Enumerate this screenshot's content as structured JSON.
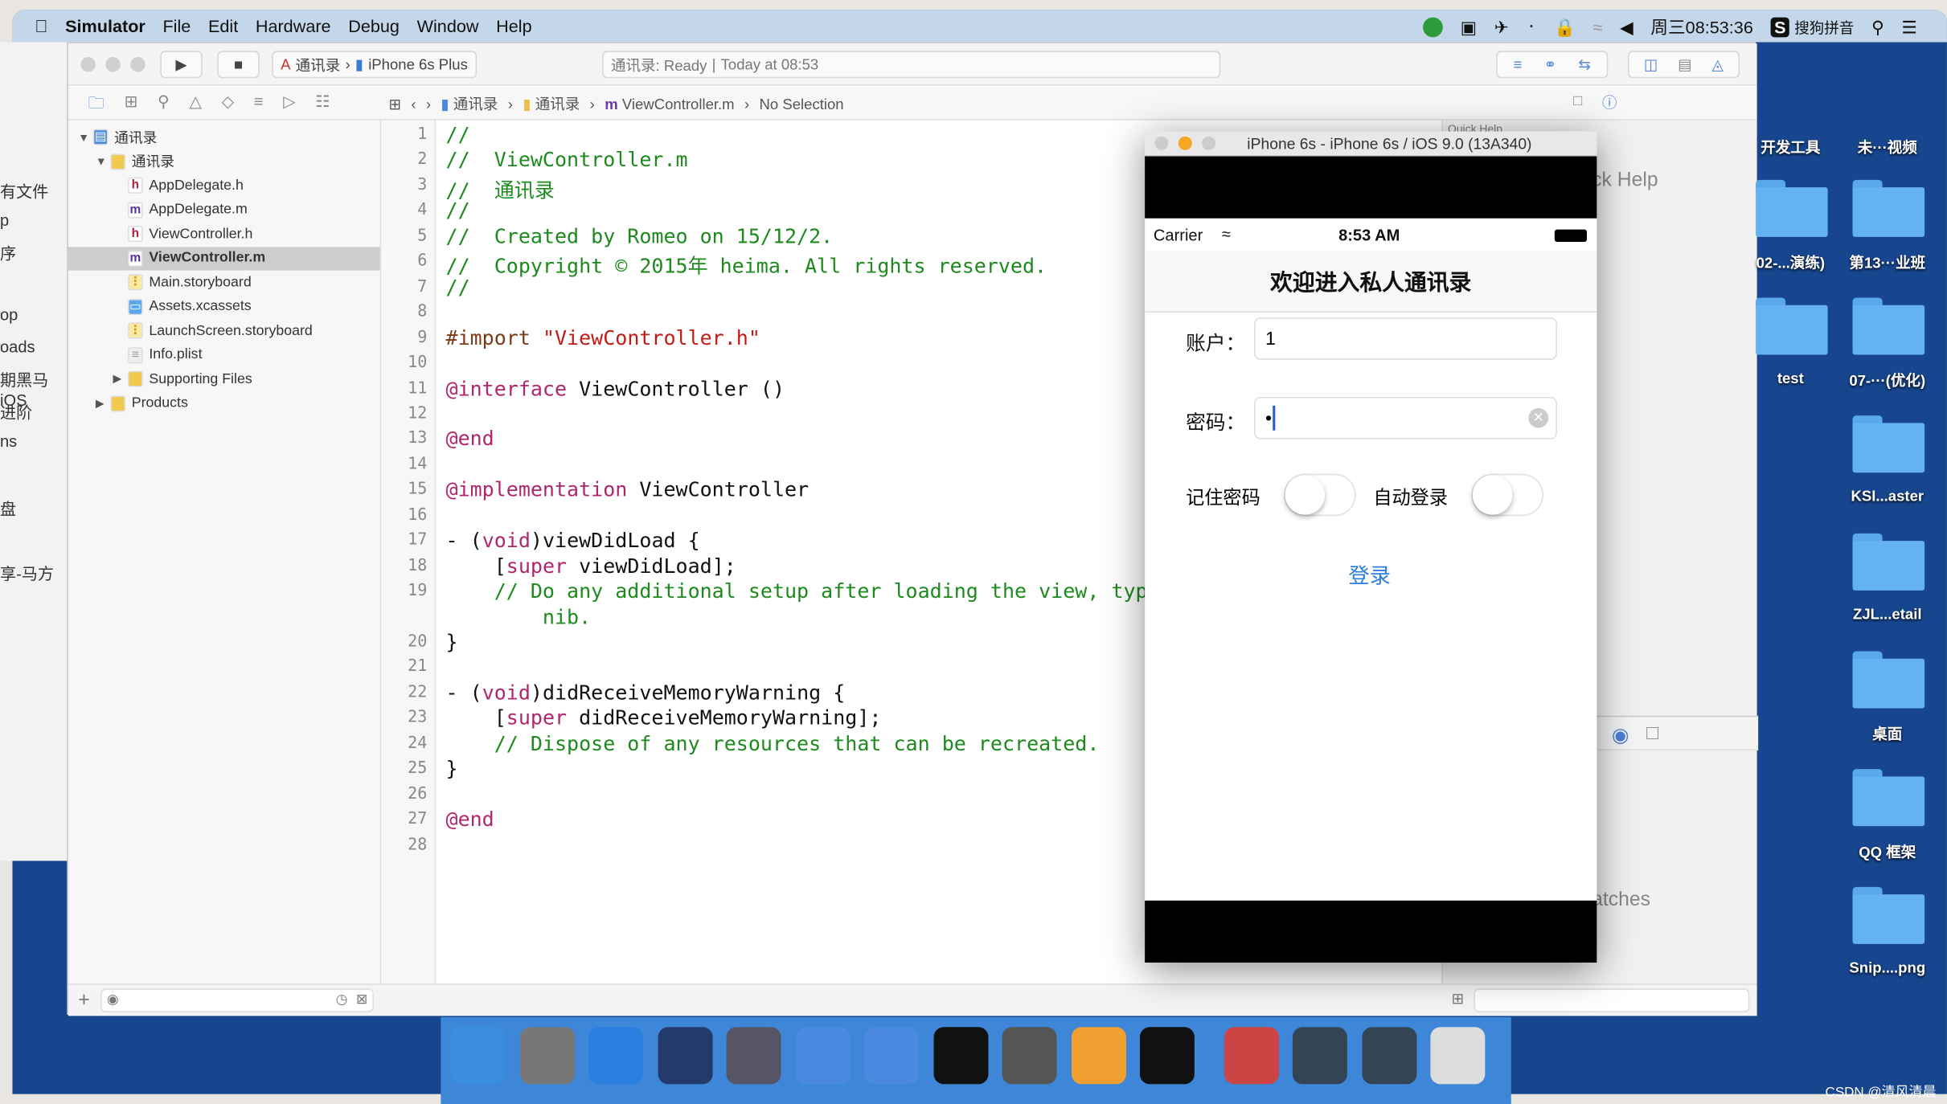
{
  "menubar": {
    "app": "Simulator",
    "items": [
      "File",
      "Edit",
      "Hardware",
      "Debug",
      "Window",
      "Help"
    ],
    "clock": "周三08:53:36",
    "ime": "搜狗拼音"
  },
  "finder_sidebar": [
    "有文件",
    "p",
    "序",
    "op",
    "oads",
    "期黑马iOS",
    "进阶",
    "ns",
    "盘",
    "享-马方"
  ],
  "toolbar": {
    "scheme": "通讯录",
    "device": "iPhone 6s Plus",
    "status": "通讯录: Ready",
    "time": "Today at 08:53"
  },
  "jumpbar": [
    "通讯录",
    "通讯录",
    "ViewController.m",
    "No Selection"
  ],
  "navigator": [
    {
      "label": "通讯录",
      "depth": 0,
      "icon": "project",
      "open": true
    },
    {
      "label": "通讯录",
      "depth": 1,
      "icon": "folder",
      "open": true
    },
    {
      "label": "AppDelegate.h",
      "depth": 2,
      "icon": "h"
    },
    {
      "label": "AppDelegate.m",
      "depth": 2,
      "icon": "m"
    },
    {
      "label": "ViewController.h",
      "depth": 2,
      "icon": "h"
    },
    {
      "label": "ViewController.m",
      "depth": 2,
      "icon": "m",
      "selected": true
    },
    {
      "label": "Main.storyboard",
      "depth": 2,
      "icon": "sb"
    },
    {
      "label": "Assets.xcassets",
      "depth": 2,
      "icon": "assets"
    },
    {
      "label": "LaunchScreen.storyboard",
      "depth": 2,
      "icon": "sb"
    },
    {
      "label": "Info.plist",
      "depth": 2,
      "icon": "plist"
    },
    {
      "label": "Supporting Files",
      "depth": 2,
      "icon": "folder",
      "open": false
    },
    {
      "label": "Products",
      "depth": 1,
      "icon": "folder",
      "open": false
    }
  ],
  "code": [
    [
      [
        "c-com",
        "//"
      ]
    ],
    [
      [
        "c-com",
        "//  ViewController.m"
      ]
    ],
    [
      [
        "c-com",
        "//  通讯录"
      ]
    ],
    [
      [
        "c-com",
        "//"
      ]
    ],
    [
      [
        "c-com",
        "//  Created by Romeo on 15/12/2."
      ]
    ],
    [
      [
        "c-com",
        "//  Copyright © 2015年 heima. All rights reserved."
      ]
    ],
    [
      [
        "c-com",
        "//"
      ]
    ],
    [],
    [
      [
        "c-pp",
        "#import "
      ],
      [
        "c-str",
        "\"ViewController.h\""
      ]
    ],
    [],
    [
      [
        "c-kw",
        "@interface"
      ],
      [
        "c-tx",
        " ViewController ()"
      ]
    ],
    [],
    [
      [
        "c-kw",
        "@end"
      ]
    ],
    [],
    [
      [
        "c-kw",
        "@implementation"
      ],
      [
        "c-tx",
        " ViewController"
      ]
    ],
    [],
    [
      [
        "c-tx",
        "- ("
      ],
      [
        "c-kw",
        "void"
      ],
      [
        "c-tx",
        ")viewDidLoad {"
      ]
    ],
    [
      [
        "c-tx",
        "    ["
      ],
      [
        "c-kw",
        "super"
      ],
      [
        "c-tx",
        " viewDidLoad];"
      ]
    ],
    [
      [
        "c-com",
        "    // Do any additional setup after loading the view, typically from a"
      ]
    ],
    [
      [
        "c-com",
        "        nib."
      ]
    ],
    [
      [
        "c-tx",
        "}"
      ]
    ],
    [],
    [
      [
        "c-tx",
        "- ("
      ],
      [
        "c-kw",
        "void"
      ],
      [
        "c-tx",
        ")didReceiveMemoryWarning {"
      ]
    ],
    [
      [
        "c-tx",
        "    ["
      ],
      [
        "c-kw",
        "super"
      ],
      [
        "c-tx",
        " didReceiveMemoryWarning];"
      ]
    ],
    [
      [
        "c-com",
        "    // Dispose of any resources that can be recreated."
      ]
    ],
    [
      [
        "c-tx",
        "}"
      ]
    ],
    [],
    [
      [
        "c-kw",
        "@end"
      ]
    ]
  ],
  "line_numbers": [
    "1",
    "2",
    "3",
    "4",
    "5",
    "6",
    "7",
    "8",
    "9",
    "10",
    "11",
    "12",
    "13",
    "14",
    "15",
    "16",
    "17",
    "18",
    "19",
    "",
    "20",
    "21",
    "22",
    "23",
    "24",
    "25",
    "26",
    "27",
    "28"
  ],
  "inspector": {
    "quick_help": "Quick Help",
    "partial_help": "ck Help",
    "partial_matches": "atches"
  },
  "simulator": {
    "title": "iPhone 6s - iPhone 6s / iOS 9.0 (13A340)",
    "carrier": "Carrier",
    "time": "8:53 AM",
    "nav_title": "欢迎进入私人通讯录",
    "account_label": "账户：",
    "account_value": "1",
    "password_label": "密码：",
    "password_value": "•",
    "remember_label": "记住密码",
    "remember_on": false,
    "autologin_label": "自动登录",
    "autologin_on": false,
    "login_button": "登录",
    "accent": "#2a7ee0"
  },
  "desktop": [
    "开发工具",
    "未···视频",
    "02-...演练)",
    "第13···业班",
    "test",
    "07-···(优化)",
    "KSI...aster",
    "ZJL...etail",
    "桌面",
    "QQ 框架",
    "Snip....png"
  ],
  "dock": [
    "Finder",
    "Launchpad",
    "Safari",
    "Mouse",
    "Photo Slideshow",
    "Xcode",
    "Instruments",
    "Terminal",
    "System Preferences",
    "Sketch",
    "Console",
    "Media Player",
    "Preview png",
    "Preview png 2",
    "Trash"
  ],
  "watermark": "CSDN @清风清晨"
}
